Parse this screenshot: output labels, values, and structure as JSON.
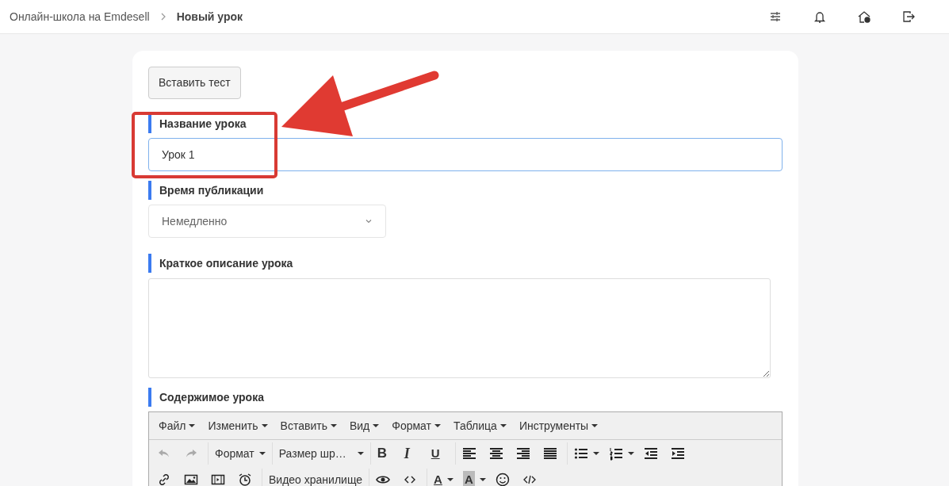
{
  "breadcrumb": [
    {
      "text": "Онлайн-школа на Emdesell",
      "current": false
    },
    {
      "text": "Новый урок",
      "current": true
    }
  ],
  "insert_test_button": "Вставить тест",
  "fields": [
    {
      "kind": "text",
      "label": "Название урока",
      "value": "Урок 1",
      "highlighted": true
    },
    {
      "kind": "select",
      "label": "Время публикации",
      "value": "Немедленно",
      "highlighted": false
    },
    {
      "kind": "textarea",
      "label": "Краткое описание урока",
      "highlighted": false
    },
    {
      "kind": "editor",
      "label": "Содержимое урока",
      "highlighted": false
    }
  ],
  "editor": {
    "menus": [
      "Файл",
      "Изменить",
      "Вставить",
      "Вид",
      "Формат",
      "Таблица",
      "Инструменты"
    ],
    "undo": {
      "disabled": true
    },
    "redo": {
      "disabled": true
    },
    "format_dropdown": "Формат",
    "font_size_dropdown": "Размер шр…",
    "bold": "B",
    "italic": "I",
    "underline": "U",
    "video_storage_button": "Видео хранилище",
    "text_color": "A",
    "background_color": "A"
  }
}
